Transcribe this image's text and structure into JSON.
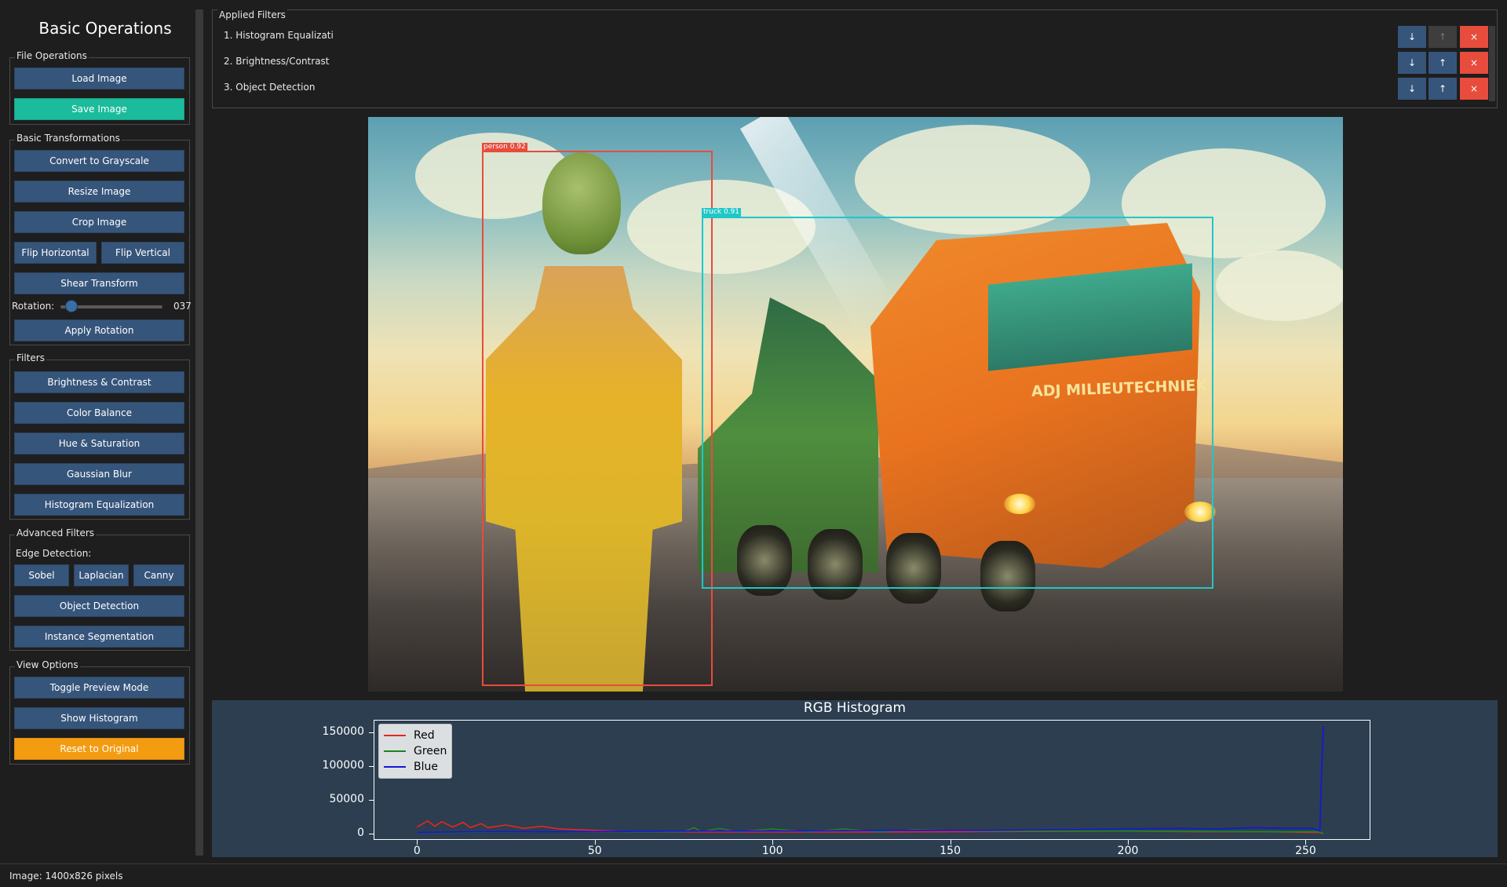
{
  "sidebar": {
    "title": "Basic Operations",
    "file_ops": {
      "label": "File Operations",
      "load": "Load Image",
      "save": "Save Image"
    },
    "basic_transforms": {
      "label": "Basic Transformations",
      "grayscale": "Convert to Grayscale",
      "resize": "Resize Image",
      "crop": "Crop Image",
      "flip_h": "Flip Horizontal",
      "flip_v": "Flip Vertical",
      "shear": "Shear Transform",
      "rotation_label": "Rotation:",
      "rotation_value": "037",
      "rotation_fraction": 0.103,
      "apply_rotation": "Apply Rotation"
    },
    "filters": {
      "label": "Filters",
      "brightness": "Brightness & Contrast",
      "color_balance": "Color Balance",
      "hue_sat": "Hue & Saturation",
      "blur": "Gaussian Blur",
      "histeq": "Histogram Equalization"
    },
    "advanced": {
      "label": "Advanced Filters",
      "edge_label": "Edge Detection:",
      "sobel": "Sobel",
      "laplacian": "Laplacian",
      "canny": "Canny",
      "object_detection": "Object Detection",
      "instance_seg": "Instance Segmentation"
    },
    "view": {
      "label": "View Options",
      "toggle_preview": "Toggle Preview Mode",
      "show_histogram": "Show Histogram",
      "reset": "Reset to Original"
    }
  },
  "applied_filters": {
    "title": "Applied Filters",
    "items": [
      {
        "label": "1. Histogram Equalizati",
        "down": "↓",
        "up": "↑",
        "remove": "×",
        "up_enabled": false
      },
      {
        "label": "2. Brightness/Contrast",
        "down": "↓",
        "up": "↑",
        "remove": "×",
        "up_enabled": true
      },
      {
        "label": "3. Object Detection",
        "down": "↓",
        "up": "↑",
        "remove": "×",
        "up_enabled": true
      }
    ]
  },
  "image": {
    "truck_lettering": "ADJ MILIEUTECHNIEK",
    "detections": [
      {
        "label": "person 0.92",
        "color": "#e74c3c"
      },
      {
        "label": "truck 0.91",
        "color": "#20c7c7"
      }
    ]
  },
  "histogram": {
    "title": "RGB Histogram",
    "legend": [
      "Red",
      "Green",
      "Blue"
    ],
    "colors": {
      "Red": "#e8261e",
      "Green": "#1a8a1a",
      "Blue": "#1515e0"
    },
    "panel_bg": "#2c3e50"
  },
  "chart_data": {
    "type": "line",
    "title": "RGB Histogram",
    "xlabel": "",
    "ylabel": "",
    "xlim": [
      -12,
      268
    ],
    "ylim": [
      -8000,
      168000
    ],
    "x_ticks": [
      "0",
      "50",
      "100",
      "150",
      "200",
      "250"
    ],
    "y_ticks": [
      "0",
      "50000",
      "100000",
      "150000"
    ],
    "legend_position": "top-left",
    "series": [
      {
        "name": "Red",
        "x": [
          0,
          3,
          5,
          7,
          10,
          13,
          15,
          18,
          20,
          25,
          30,
          35,
          40,
          50,
          60,
          80,
          100,
          120,
          150,
          180,
          200,
          220,
          240,
          250,
          254,
          255
        ],
        "values": [
          10000,
          19000,
          11000,
          18000,
          10000,
          17000,
          9000,
          15000,
          9000,
          13000,
          8000,
          11000,
          7000,
          5000,
          3000,
          2500,
          2500,
          2500,
          3000,
          3500,
          4000,
          3000,
          3000,
          2000,
          2000,
          0
        ]
      },
      {
        "name": "Green",
        "x": [
          0,
          10,
          20,
          40,
          60,
          75,
          78,
          80,
          85,
          90,
          100,
          110,
          120,
          130,
          140,
          160,
          180,
          200,
          220,
          240,
          250,
          254,
          255
        ],
        "values": [
          2000,
          2000,
          2500,
          3000,
          3000,
          3000,
          9000,
          3000,
          8000,
          3000,
          7000,
          3000,
          7000,
          3000,
          6000,
          4000,
          4000,
          4000,
          3500,
          3000,
          3000,
          3000,
          0
        ]
      },
      {
        "name": "Blue",
        "x": [
          0,
          20,
          40,
          60,
          80,
          100,
          120,
          140,
          160,
          180,
          200,
          215,
          225,
          235,
          245,
          252,
          254,
          254.5,
          255
        ],
        "values": [
          2000,
          3000,
          3000,
          3500,
          4000,
          4000,
          4500,
          5000,
          5000,
          6000,
          7000,
          8000,
          7000,
          9000,
          8000,
          8000,
          4000,
          100000,
          160000
        ]
      }
    ]
  },
  "status": {
    "text": "Image: 1400x826 pixels"
  }
}
